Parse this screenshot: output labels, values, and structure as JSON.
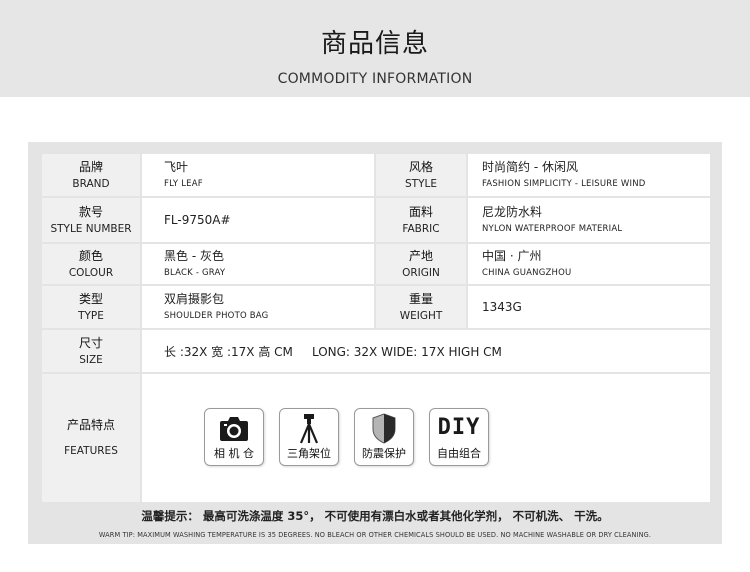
{
  "header": {
    "title": "商品信息",
    "subtitle": "COMMODITY INFORMATION"
  },
  "specs": {
    "brand": {
      "label_zh": "品牌",
      "label_en": "BRAND",
      "value_zh": "飞叶",
      "value_en": "FLY LEAF"
    },
    "style": {
      "label_zh": "风格",
      "label_en": "STYLE",
      "value_zh": "时尚简约 - 休闲风",
      "value_en": "FASHION SIMPLICITY - LEISURE WIND"
    },
    "number": {
      "label_zh": "款号",
      "label_en": "STYLE NUMBER",
      "value": "FL-9750A#"
    },
    "fabric": {
      "label_zh": "面料",
      "label_en": "FABRIC",
      "value_zh": "尼龙防水料",
      "value_en": "NYLON WATERPROOF MATERIAL"
    },
    "colour": {
      "label_zh": "颜色",
      "label_en": "COLOUR",
      "value_zh": "黑色 - 灰色",
      "value_en": "BLACK - GRAY"
    },
    "origin": {
      "label_zh": "产地",
      "label_en": "ORIGIN",
      "value_zh": "中国 · 广州",
      "value_en": "CHINA GUANGZHOU"
    },
    "type": {
      "label_zh": "类型",
      "label_en": "TYPE",
      "value_zh": "双肩摄影包",
      "value_en": "SHOULDER PHOTO BAG"
    },
    "weight": {
      "label_zh": "重量",
      "label_en": "WEIGHT",
      "value": "1343G"
    },
    "size": {
      "label_zh": "尺寸",
      "label_en": "SIZE",
      "value": "长 :32X 宽 :17X 高 CM     LONG: 32X WIDE: 17X HIGH CM"
    }
  },
  "features": {
    "label_zh": "产品特点",
    "label_en": "FEATURES",
    "items": [
      {
        "icon": "camera-icon",
        "caption": "相 机 仓"
      },
      {
        "icon": "tripod-icon",
        "caption": "三角架位"
      },
      {
        "icon": "shield-icon",
        "caption": "防震保护"
      },
      {
        "icon": "diy-icon",
        "icon_text": "DIY",
        "caption": "自由组合"
      }
    ]
  },
  "warm_tip": {
    "zh": "温馨提示： 最高可洗涤温度 35°，  不可使用有漂白水或者其他化学剂，  不可机洗、  干洗。",
    "en": "WARM TIP: MAXIMUM WASHING TEMPERATURE IS 35 DEGREES. NO BLEACH OR OTHER CHEMICALS SHOULD BE USED. NO MACHINE WASHABLE OR DRY CLEANING."
  }
}
